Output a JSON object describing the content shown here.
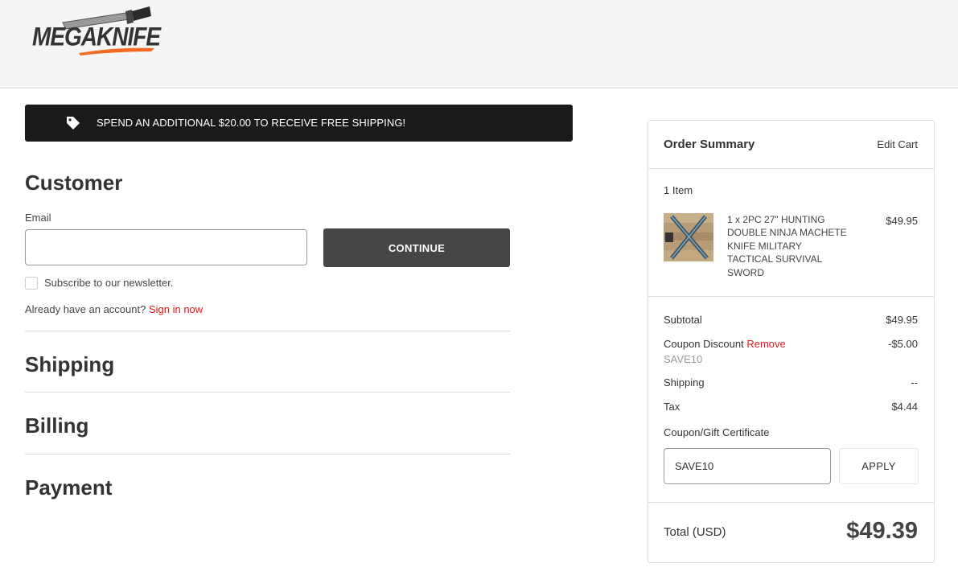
{
  "header": {
    "logo_text": "MEGAKNIFE",
    "colors": {
      "logo_red": "#e4161b",
      "logo_dark": "#333333",
      "logo_swoosh": "#f26b21"
    }
  },
  "banner": {
    "icon": "tag-icon",
    "message": "SPEND AN ADDITIONAL $20.00 TO RECEIVE FREE SHIPPING!"
  },
  "customer": {
    "title": "Customer",
    "email_label": "Email",
    "email_value": "",
    "continue_label": "CONTINUE",
    "newsletter_label": "Subscribe to our newsletter.",
    "newsletter_checked": false,
    "account_prompt": "Already have an account?",
    "sign_in_label": "Sign in now"
  },
  "steps": {
    "shipping": "Shipping",
    "billing": "Billing",
    "payment": "Payment"
  },
  "order_summary": {
    "title": "Order Summary",
    "edit_cart": "Edit Cart",
    "item_count": "1 Item",
    "item": {
      "name_lines": [
        "1 x 2PC 27\" HUNTING",
        "DOUBLE NINJA MACHETE",
        "KNIFE MILITARY",
        "TACTICAL SURVIVAL",
        "SWORD"
      ],
      "price": "$49.95"
    },
    "subtotal_label": "Subtotal",
    "subtotal_value": "$49.95",
    "coupon_label": "Coupon Discount",
    "coupon_remove": "Remove",
    "coupon_code": "SAVE10",
    "coupon_value": "-$5.00",
    "shipping_label": "Shipping",
    "shipping_value": "--",
    "tax_label": "Tax",
    "tax_value": "$4.44",
    "gift_label": "Coupon/Gift Certificate",
    "gift_input_value": "SAVE10",
    "apply_label": "APPLY",
    "total_label": "Total (USD)",
    "total_value": "$49.39"
  },
  "colors": {
    "accent_red": "#e4161b",
    "button_dark": "#454545",
    "banner_bg": "#1a1a1a"
  }
}
